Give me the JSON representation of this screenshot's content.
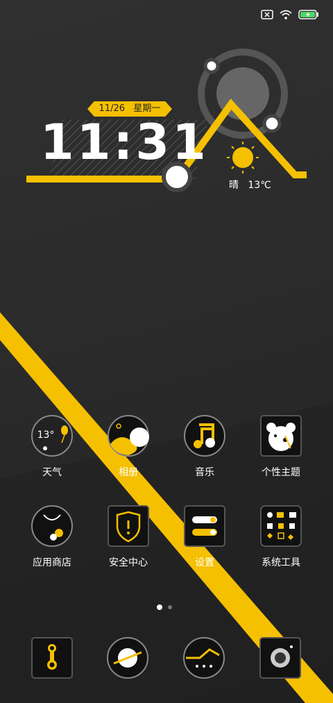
{
  "status": {
    "icons": [
      "no-sim-icon",
      "wifi-icon",
      "battery-charging-icon"
    ]
  },
  "widget": {
    "date": "11/26",
    "weekday": "星期一",
    "time": "11:31",
    "weather": "晴",
    "temp": "13℃"
  },
  "apps": [
    {
      "label": "天气",
      "icon": "weather-icon",
      "temp": "13°"
    },
    {
      "label": "相册",
      "icon": "gallery-icon"
    },
    {
      "label": "音乐",
      "icon": "music-icon"
    },
    {
      "label": "个性主题",
      "icon": "themes-icon"
    },
    {
      "label": "应用商店",
      "icon": "app-store-icon"
    },
    {
      "label": "安全中心",
      "icon": "security-icon"
    },
    {
      "label": "设置",
      "icon": "settings-icon"
    },
    {
      "label": "系统工具",
      "icon": "system-tools-icon"
    }
  ],
  "page_indicator": {
    "current": 1,
    "total": 2
  },
  "dock": [
    "phone-icon",
    "browser-icon",
    "messages-icon",
    "camera-icon"
  ],
  "colors": {
    "accent": "#f5c000",
    "background": "#2b2b2b"
  }
}
